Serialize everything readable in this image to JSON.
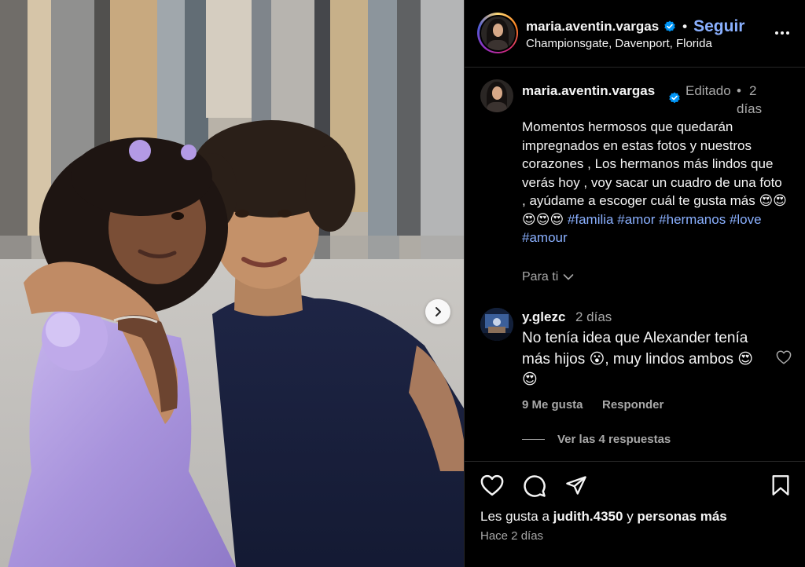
{
  "post": {
    "username": "maria.aventin.vargas",
    "separator": "•",
    "follow_label": "Seguir",
    "location": "Championsgate, Davenport, Florida"
  },
  "caption": {
    "username": "maria.aventin.vargas",
    "edited": "Editado",
    "dot": "•",
    "time": "2 días",
    "text": "Momentos hermosos que quedarán impregnados en estas fotos y nuestros corazones , Los hermanos más lindos que verás hoy , voy sacar un cuadro de una foto , ayúdame a escoger cuál te gusta más 😍😍😍😍😍",
    "hashtags": [
      "#familia",
      "#amor",
      "#hermanos",
      "#love",
      "#amour"
    ],
    "translation_toggle": "Para ti"
  },
  "comment": {
    "username": "y.glezc",
    "time": "2 días",
    "text": "No tenía idea que Alexander tenía más hijos 😮, muy lindos ambos 😍😍",
    "likes": "9 Me gusta",
    "reply": "Responder",
    "view_replies": "Ver las 4 respuestas"
  },
  "footer": {
    "likes_prefix": "Les gusta a",
    "likes_user": "judith.4350",
    "likes_middle": "y",
    "likes_suffix": "personas más",
    "posted": "Hace 2 días"
  },
  "icons": {
    "verified": "verified-badge-icon",
    "more": "more-options-icon",
    "next": "chevron-right-icon",
    "like": "heart-icon",
    "comment": "comment-bubble-icon",
    "share": "paper-plane-icon",
    "save": "bookmark-icon",
    "chevron": "chevron-down-icon"
  },
  "colors": {
    "background": "#000000",
    "link": "#8ab0ff",
    "muted": "#a8a8a8",
    "verified": "#0095f6"
  }
}
